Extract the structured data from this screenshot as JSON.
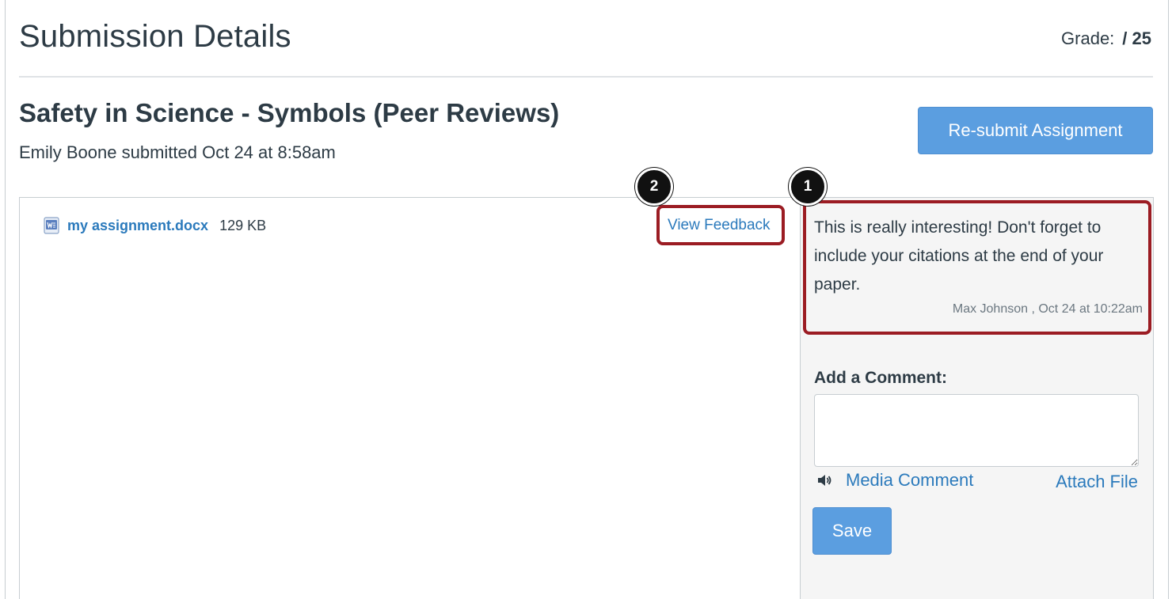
{
  "header": {
    "title": "Submission Details",
    "grade_label": "Grade:",
    "grade_max": "/ 25"
  },
  "assignment": {
    "title": "Safety in Science - Symbols (Peer Reviews)",
    "submitted_line": "Emily Boone submitted Oct 24 at 8:58am",
    "resubmit_label": "Re-submit Assignment"
  },
  "file": {
    "name": "my assignment.docx",
    "size": "129 KB",
    "icon": "word-document-icon",
    "view_feedback_label": "View Feedback"
  },
  "comment": {
    "text": "This is really interesting! Don't forget to include your citations at the end of your paper.",
    "meta": "Max Johnson , Oct 24 at 10:22am"
  },
  "add_comment": {
    "label": "Add a Comment:",
    "value": "",
    "media_label": "Media Comment",
    "media_icon": "speaker-icon",
    "attach_label": "Attach File",
    "save_label": "Save"
  },
  "callouts": {
    "badge_1": "1",
    "badge_2": "2"
  },
  "colors": {
    "link": "#2b7abc",
    "button": "#5b9ee0",
    "highlight": "#9b1c23",
    "sidebar_bg": "#f5f5f5"
  }
}
